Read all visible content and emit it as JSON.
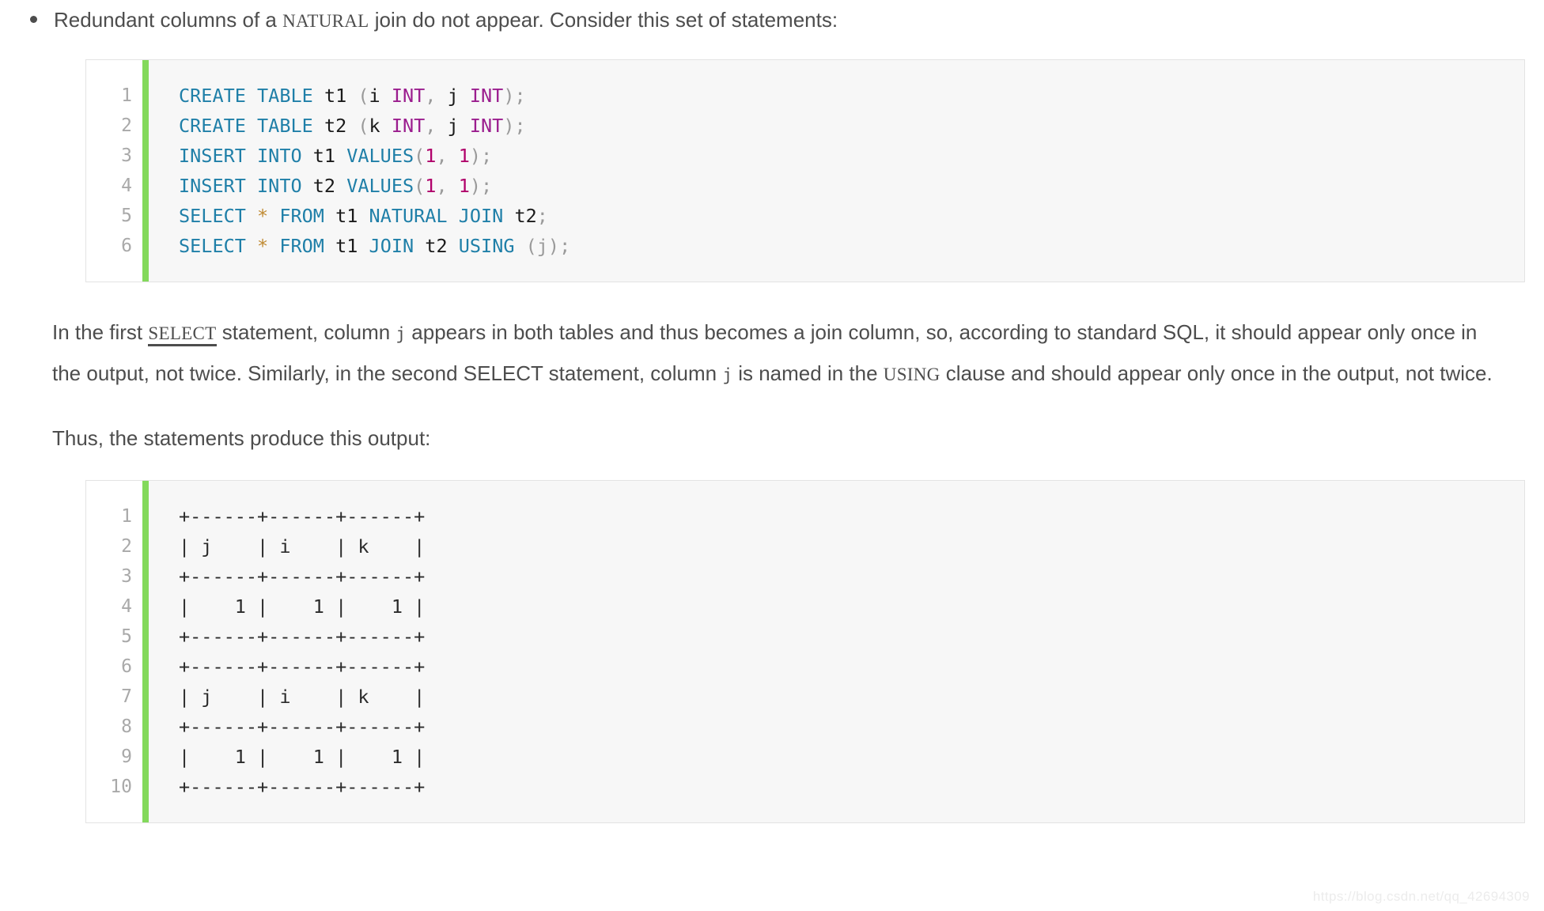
{
  "colors": {
    "accent_green": "#83d95b",
    "code_bg": "#f7f7f7",
    "gutter_bg": "#ffffff",
    "border": "#e3e3e3",
    "text": "#4d4d4d",
    "keyword": "#1f7fa8",
    "type": "#9b1d8e",
    "number": "#b0006a",
    "operator": "#c08a32",
    "punctuation": "#9a9a9a",
    "line_number": "#a9a9a9",
    "watermark": "#ececec"
  },
  "bullet": {
    "marker": "bullet-dot",
    "text_before": "Redundant columns of a ",
    "code_term": "NATURAL",
    "text_after": " join do not appear. Consider this set of statements:"
  },
  "sql_block": {
    "line_numbers": [
      "1",
      "2",
      "3",
      "4",
      "5",
      "6"
    ],
    "lines": [
      "CREATE TABLE t1 (i INT, j INT);",
      "CREATE TABLE t2 (k INT, j INT);",
      "INSERT INTO t1 VALUES(1, 1);",
      "INSERT INTO t2 VALUES(1, 1);",
      "SELECT * FROM t1 NATURAL JOIN t2;",
      "SELECT * FROM t1 JOIN t2 USING (j);"
    ],
    "tokens": [
      [
        {
          "t": "CREATE TABLE ",
          "c": "tok-kw"
        },
        {
          "t": "t1 ",
          "c": "tok-plain"
        },
        {
          "t": "(",
          "c": "tok-punc"
        },
        {
          "t": "i ",
          "c": "tok-plain"
        },
        {
          "t": "INT",
          "c": "tok-type"
        },
        {
          "t": ", ",
          "c": "tok-punc"
        },
        {
          "t": "j ",
          "c": "tok-plain"
        },
        {
          "t": "INT",
          "c": "tok-type"
        },
        {
          "t": ");",
          "c": "tok-punc"
        }
      ],
      [
        {
          "t": "CREATE TABLE ",
          "c": "tok-kw"
        },
        {
          "t": "t2 ",
          "c": "tok-plain"
        },
        {
          "t": "(",
          "c": "tok-punc"
        },
        {
          "t": "k ",
          "c": "tok-plain"
        },
        {
          "t": "INT",
          "c": "tok-type"
        },
        {
          "t": ", ",
          "c": "tok-punc"
        },
        {
          "t": "j ",
          "c": "tok-plain"
        },
        {
          "t": "INT",
          "c": "tok-type"
        },
        {
          "t": ");",
          "c": "tok-punc"
        }
      ],
      [
        {
          "t": "INSERT INTO ",
          "c": "tok-kw"
        },
        {
          "t": "t1 ",
          "c": "tok-plain"
        },
        {
          "t": "VALUES",
          "c": "tok-kw"
        },
        {
          "t": "(",
          "c": "tok-punc"
        },
        {
          "t": "1",
          "c": "tok-num"
        },
        {
          "t": ", ",
          "c": "tok-punc"
        },
        {
          "t": "1",
          "c": "tok-num"
        },
        {
          "t": ");",
          "c": "tok-punc"
        }
      ],
      [
        {
          "t": "INSERT INTO ",
          "c": "tok-kw"
        },
        {
          "t": "t2 ",
          "c": "tok-plain"
        },
        {
          "t": "VALUES",
          "c": "tok-kw"
        },
        {
          "t": "(",
          "c": "tok-punc"
        },
        {
          "t": "1",
          "c": "tok-num"
        },
        {
          "t": ", ",
          "c": "tok-punc"
        },
        {
          "t": "1",
          "c": "tok-num"
        },
        {
          "t": ");",
          "c": "tok-punc"
        }
      ],
      [
        {
          "t": "SELECT ",
          "c": "tok-kw"
        },
        {
          "t": "* ",
          "c": "tok-op"
        },
        {
          "t": "FROM ",
          "c": "tok-kw"
        },
        {
          "t": "t1 ",
          "c": "tok-plain"
        },
        {
          "t": "NATURAL JOIN ",
          "c": "tok-kw"
        },
        {
          "t": "t2",
          "c": "tok-plain"
        },
        {
          "t": ";",
          "c": "tok-punc"
        }
      ],
      [
        {
          "t": "SELECT ",
          "c": "tok-kw"
        },
        {
          "t": "* ",
          "c": "tok-op"
        },
        {
          "t": "FROM ",
          "c": "tok-kw"
        },
        {
          "t": "t1 ",
          "c": "tok-plain"
        },
        {
          "t": "JOIN ",
          "c": "tok-kw"
        },
        {
          "t": "t2 ",
          "c": "tok-plain"
        },
        {
          "t": "USING ",
          "c": "tok-kw"
        },
        {
          "t": "(j);",
          "c": "tok-punc"
        }
      ]
    ]
  },
  "paragraph_1": {
    "seg_1": "In the first ",
    "code_1": "SELECT",
    "seg_2": " statement, column ",
    "code_2": "j",
    "seg_3": " appears in both tables and thus becomes a join column, so, according to standard SQL, it should appear only once in the output, not twice. Similarly, in the second SELECT statement, column ",
    "code_3": "j",
    "seg_4": " is named in the ",
    "code_4": "USING",
    "seg_5": " clause and should appear only once in the output, not twice."
  },
  "paragraph_2": {
    "text": "Thus, the statements produce this output:"
  },
  "output_block": {
    "line_numbers": [
      "1",
      "2",
      "3",
      "4",
      "5",
      "6",
      "7",
      "8",
      "9",
      "10"
    ],
    "lines": [
      "+------+------+------+",
      "| j    | i    | k    |",
      "+------+------+------+",
      "|    1 |    1 |    1 |",
      "+------+------+------+",
      "+------+------+------+",
      "| j    | i    | k    |",
      "+------+------+------+",
      "|    1 |    1 |    1 |",
      "+------+------+------+"
    ],
    "result_tables": [
      {
        "columns": [
          "j",
          "i",
          "k"
        ],
        "rows": [
          [
            "1",
            "1",
            "1"
          ]
        ]
      },
      {
        "columns": [
          "j",
          "i",
          "k"
        ],
        "rows": [
          [
            "1",
            "1",
            "1"
          ]
        ]
      }
    ]
  },
  "watermark": {
    "text": "https://blog.csdn.net/qq_42694309"
  }
}
